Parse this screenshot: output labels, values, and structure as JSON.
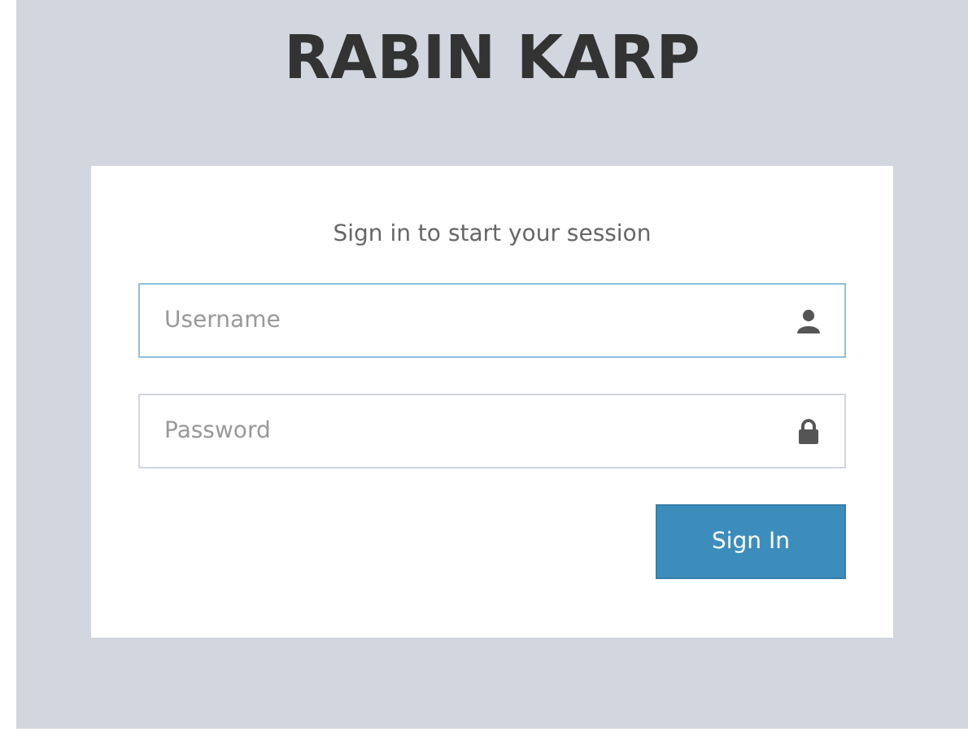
{
  "logo": "RABIN KARP",
  "login": {
    "message": "Sign in to start your session",
    "fields": [
      {
        "placeholder": "Username",
        "kind": "user",
        "focused": true
      },
      {
        "placeholder": "Password",
        "kind": "password",
        "focused": false
      }
    ],
    "button": "Sign In"
  }
}
